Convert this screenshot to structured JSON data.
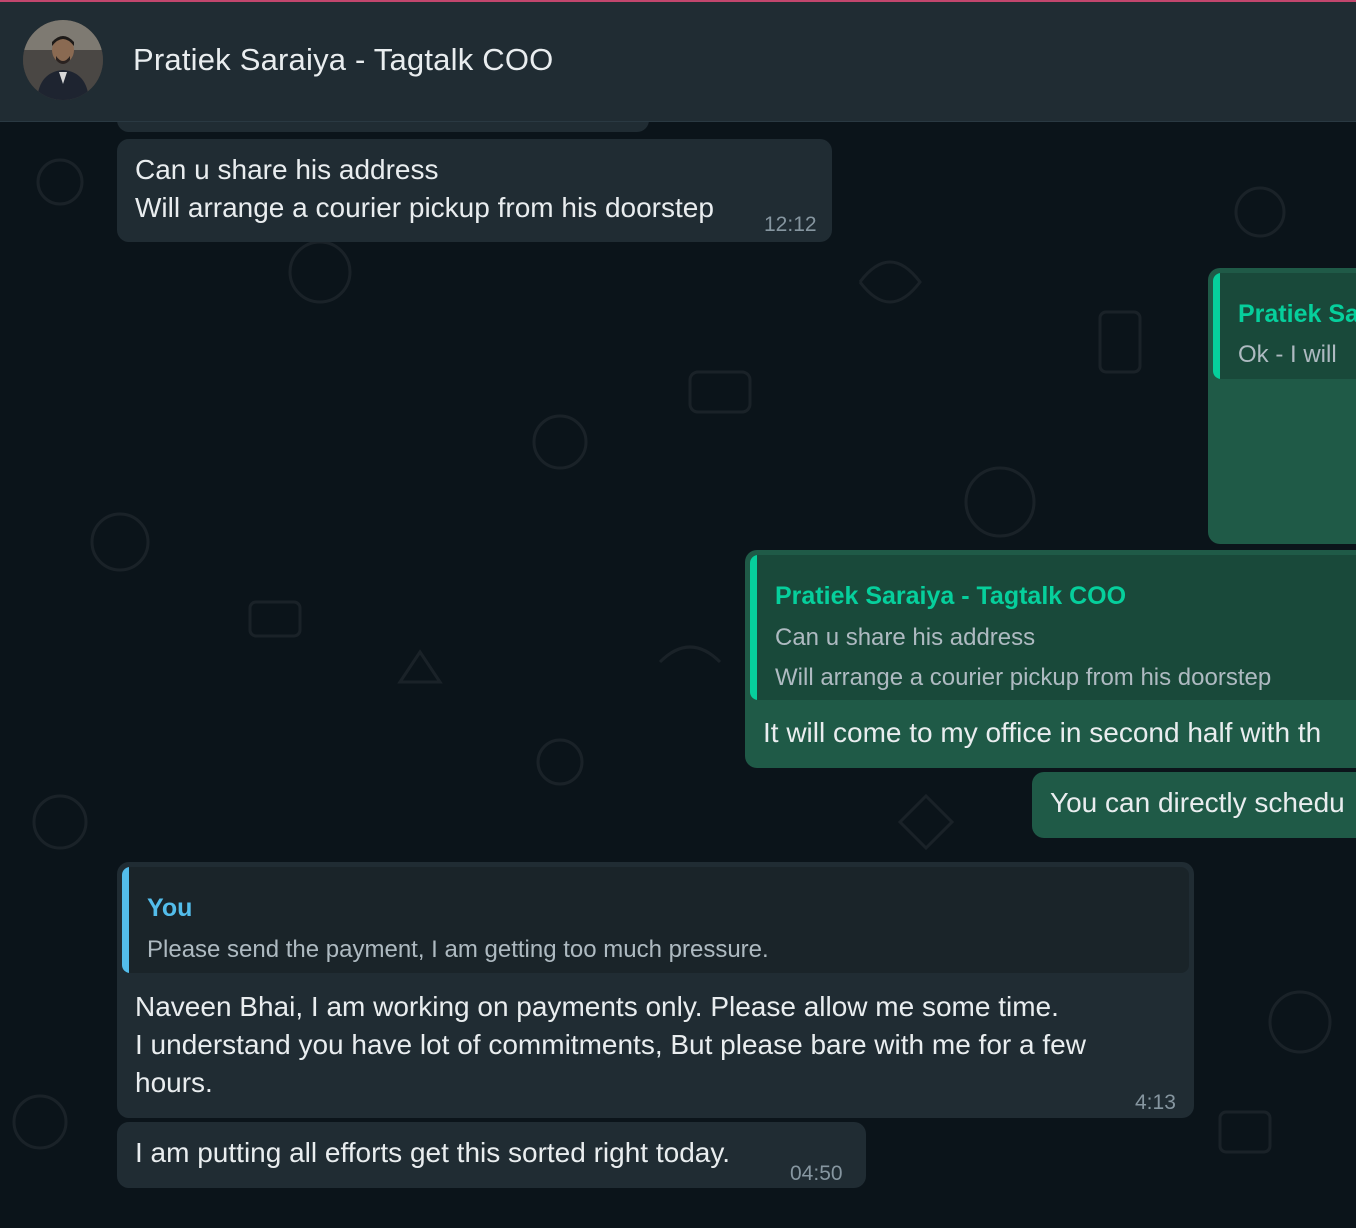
{
  "header": {
    "contact_name": "Pratiek Saraiya - Tagtalk COO",
    "avatar_icon": "profile-photo"
  },
  "messages": {
    "m1": {
      "lines": [
        "Can u share his address",
        "Will arrange a courier pickup from his doorstep"
      ],
      "time": "12:12"
    },
    "m2": {
      "quote_name": "Pratiek Sa",
      "quote_text": "Ok - I will"
    },
    "m3": {
      "quote_name": "Pratiek Saraiya - Tagtalk COO",
      "quote_lines": [
        "Can u share his address",
        "Will arrange a courier pickup from his doorstep"
      ],
      "body": "It will come to my office in second half with th"
    },
    "m4": {
      "body": "You can directly schedu"
    },
    "m5": {
      "quote_name": "You",
      "quote_text": "Please send the payment, I am getting too much pressure.",
      "lines": [
        "Naveen Bhai, I am working on payments only. Please allow me some time.",
        "I understand you have lot of commitments, But please bare with me for a few",
        "hours."
      ],
      "time": "4:13"
    },
    "m6": {
      "body": "I am putting all efforts get this sorted right today.",
      "time": "04:50"
    }
  },
  "colors": {
    "incoming_bubble": "#202c33",
    "outgoing_bubble": "#1f5a47",
    "quote_you_accent": "#53bdeb",
    "quote_contact_accent": "#06cf9c",
    "header_bg": "#202c33",
    "chat_bg": "#0b141a"
  }
}
